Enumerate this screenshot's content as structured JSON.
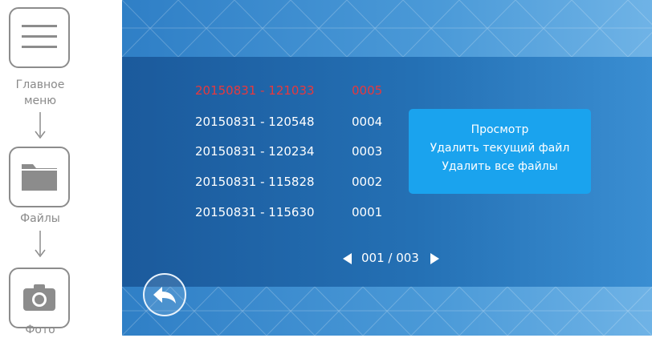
{
  "guide": {
    "steps": [
      {
        "label": "Главное меню",
        "icon": "hamburger-menu-icon"
      },
      {
        "label": "Файлы",
        "icon": "folder-icon"
      },
      {
        "label": "Фото",
        "icon": "camera-icon"
      }
    ]
  },
  "files": {
    "rows": [
      {
        "name": "20150831 - 121033",
        "num": "0005",
        "selected": true
      },
      {
        "name": "20150831 - 120548",
        "num": "0004",
        "selected": false
      },
      {
        "name": "20150831 - 120234",
        "num": "0003",
        "selected": false
      },
      {
        "name": "20150831 - 115828",
        "num": "0002",
        "selected": false
      },
      {
        "name": "20150831 - 115630",
        "num": "0001",
        "selected": false
      }
    ],
    "selected_color": "#e8383d"
  },
  "context_menu": {
    "items": [
      "Просмотр",
      "Удалить текущий файл",
      "Удалить все файлы"
    ],
    "color": "#1aa3ee"
  },
  "pager": {
    "text": "001 / 003"
  },
  "icons": {
    "prev": "triangle-left-icon",
    "next": "triangle-right-icon",
    "back": "back-arrow-icon"
  }
}
